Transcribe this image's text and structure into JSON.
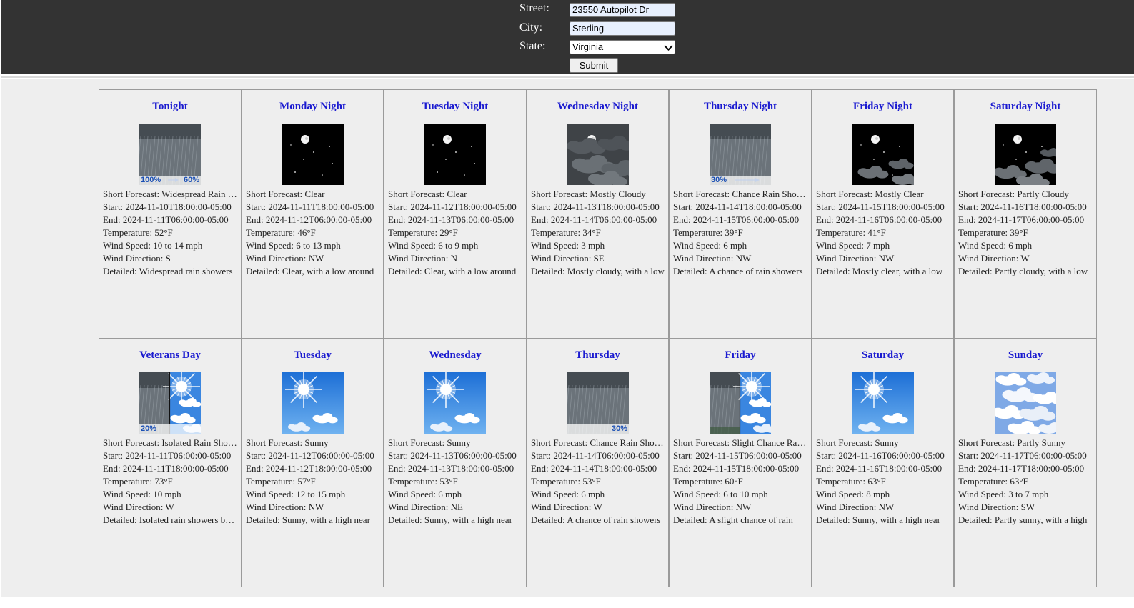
{
  "form": {
    "street_label": "Street:",
    "street_value": "23550 Autopilot Dr",
    "city_label": "City:",
    "city_value": "Sterling",
    "state_label": "State:",
    "state_value": "Virginia",
    "submit_label": "Submit"
  },
  "labels": {
    "short": "Short Forecast: ",
    "start": "Start: ",
    "end": "End: ",
    "temperature": "Temperature: ",
    "wind_speed": "Wind Speed: ",
    "wind_direction": "Wind Direction: ",
    "detailed": "Detailed: "
  },
  "periods": [
    {
      "name": "Tonight",
      "icon": "rain-icon",
      "pop_left": "100%",
      "pop_right": "60%",
      "short": "Widespread Rain Showers",
      "start": "2024-11-10T18:00:00-05:00",
      "end": "2024-11-11T06:00:00-05:00",
      "temperature": "52°F",
      "wind_speed": "10 to 14 mph",
      "wind_direction": "S",
      "detailed": "Widespread rain showers"
    },
    {
      "name": "Monday Night",
      "icon": "clear-night-icon",
      "short": "Clear",
      "start": "2024-11-11T18:00:00-05:00",
      "end": "2024-11-12T06:00:00-05:00",
      "temperature": "46°F",
      "wind_speed": "6 to 13 mph",
      "wind_direction": "NW",
      "detailed": "Clear, with a low around"
    },
    {
      "name": "Tuesday Night",
      "icon": "clear-night-icon",
      "short": "Clear",
      "start": "2024-11-12T18:00:00-05:00",
      "end": "2024-11-13T06:00:00-05:00",
      "temperature": "29°F",
      "wind_speed": "6 to 9 mph",
      "wind_direction": "N",
      "detailed": "Clear, with a low around"
    },
    {
      "name": "Wednesday Night",
      "icon": "mostly-cloudy-night-icon",
      "short": "Mostly Cloudy",
      "start": "2024-11-13T18:00:00-05:00",
      "end": "2024-11-14T06:00:00-05:00",
      "temperature": "34°F",
      "wind_speed": "3 mph",
      "wind_direction": "SE",
      "detailed": "Mostly cloudy, with a low"
    },
    {
      "name": "Thursday Night",
      "icon": "rain-icon",
      "pop_left": "30%",
      "arrow": true,
      "short": "Chance Rain Showers",
      "start": "2024-11-14T18:00:00-05:00",
      "end": "2024-11-15T06:00:00-05:00",
      "temperature": "39°F",
      "wind_speed": "6 mph",
      "wind_direction": "NW",
      "detailed": "A chance of rain showers"
    },
    {
      "name": "Friday Night",
      "icon": "mostly-clear-night-icon",
      "short": "Mostly Clear",
      "start": "2024-11-15T18:00:00-05:00",
      "end": "2024-11-16T06:00:00-05:00",
      "temperature": "41°F",
      "wind_speed": "7 mph",
      "wind_direction": "NW",
      "detailed": "Mostly clear, with a low"
    },
    {
      "name": "Saturday Night",
      "icon": "partly-cloudy-night-icon",
      "short": "Partly Cloudy",
      "start": "2024-11-16T18:00:00-05:00",
      "end": "2024-11-17T06:00:00-05:00",
      "temperature": "39°F",
      "wind_speed": "6 mph",
      "wind_direction": "W",
      "detailed": "Partly cloudy, with a low"
    },
    {
      "name": "Veterans Day",
      "icon": "rain-to-sunny-icon",
      "pop_left": "20%",
      "short": "Isolated Rain Showers",
      "start": "2024-11-11T06:00:00-05:00",
      "end": "2024-11-11T18:00:00-05:00",
      "temperature": "73°F",
      "wind_speed": "10 mph",
      "wind_direction": "W",
      "detailed": "Isolated rain showers before"
    },
    {
      "name": "Tuesday",
      "icon": "sunny-icon",
      "short": "Sunny",
      "start": "2024-11-12T06:00:00-05:00",
      "end": "2024-11-12T18:00:00-05:00",
      "temperature": "57°F",
      "wind_speed": "12 to 15 mph",
      "wind_direction": "NW",
      "detailed": "Sunny, with a high near"
    },
    {
      "name": "Wednesday",
      "icon": "sunny-icon",
      "short": "Sunny",
      "start": "2024-11-13T06:00:00-05:00",
      "end": "2024-11-13T18:00:00-05:00",
      "temperature": "53°F",
      "wind_speed": "6 mph",
      "wind_direction": "NE",
      "detailed": "Sunny, with a high near"
    },
    {
      "name": "Thursday",
      "icon": "rain-icon",
      "pop_right": "30%",
      "short": "Chance Rain Showers",
      "start": "2024-11-14T06:00:00-05:00",
      "end": "2024-11-14T18:00:00-05:00",
      "temperature": "53°F",
      "wind_speed": "6 mph",
      "wind_direction": "W",
      "detailed": "A chance of rain showers"
    },
    {
      "name": "Friday",
      "icon": "rain-to-sunny-icon",
      "short": "Slight Chance Rain Showers",
      "start": "2024-11-15T06:00:00-05:00",
      "end": "2024-11-15T18:00:00-05:00",
      "temperature": "60°F",
      "wind_speed": "6 to 10 mph",
      "wind_direction": "NW",
      "detailed": "A slight chance of rain"
    },
    {
      "name": "Saturday",
      "icon": "sunny-icon",
      "short": "Sunny",
      "start": "2024-11-16T06:00:00-05:00",
      "end": "2024-11-16T18:00:00-05:00",
      "temperature": "63°F",
      "wind_speed": "8 mph",
      "wind_direction": "NW",
      "detailed": "Sunny, with a high near"
    },
    {
      "name": "Sunday",
      "icon": "partly-sunny-icon",
      "short": "Partly Sunny",
      "start": "2024-11-17T06:00:00-05:00",
      "end": "2024-11-17T18:00:00-05:00",
      "temperature": "63°F",
      "wind_speed": "3 to 7 mph",
      "wind_direction": "SW",
      "detailed": "Partly sunny, with a high"
    }
  ]
}
